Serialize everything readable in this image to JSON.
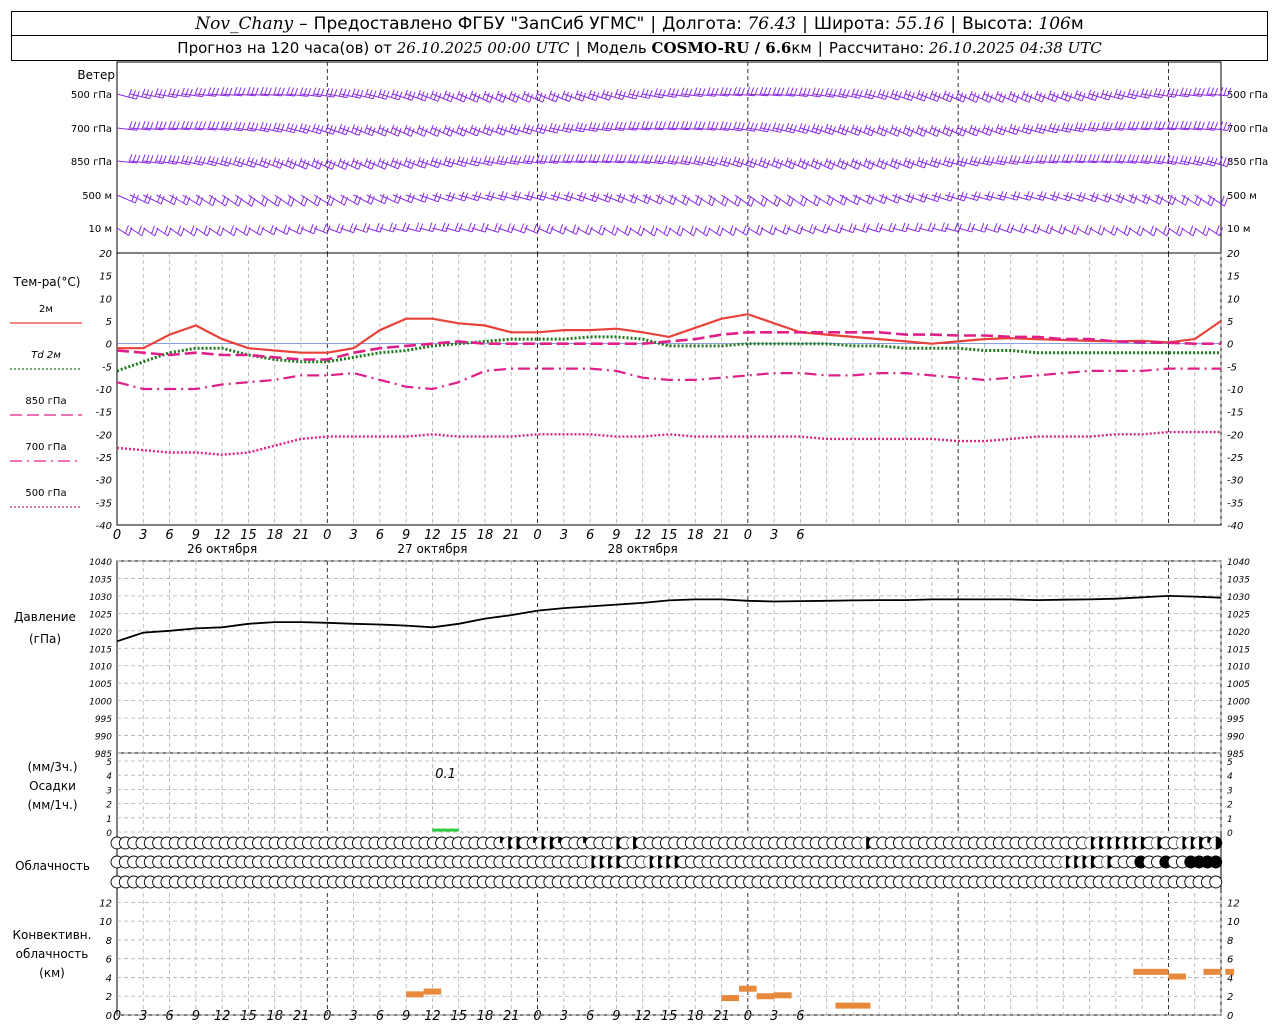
{
  "header": {
    "station": "Nov_Chany",
    "provider": "Предоставлено ФГБУ \"ЗапСиб УГМС\"",
    "lon_label": "Долгота:",
    "lon_value": "76.43",
    "lat_label": "Широта:",
    "lat_value": "55.16",
    "alt_label": "Высота:",
    "alt_value": "106",
    "alt_unit": "м",
    "forecast_prefix": "Прогноз на 120 часа(ов) от",
    "forecast_start": "26.10.2025 00:00 UTC",
    "model_label": "Модель",
    "model_name": "COSMO-RU / 6.6",
    "model_unit": "км",
    "computed_label": "Рассчитано:",
    "computed_value": "26.10.2025 04:38 UTC"
  },
  "labels": {
    "wind_title": "Ветер",
    "temp_title": "Тем-ра(°С)",
    "pressure_title": "Давление",
    "pressure_unit": "(гПа)",
    "precip_unit_top": "(мм/3ч.)",
    "precip_title": "Осадки",
    "precip_unit_bottom": "(мм/1ч.)",
    "cloud_title": "Облачность",
    "conv_line1": "Конвективн.",
    "conv_line2": "облачность",
    "conv_unit": "(км)",
    "precip_max": "0.1"
  },
  "colors": {
    "wind": "#8a2be2",
    "t2m": "#e8423a",
    "td2m": "#1a7a1a",
    "t850": "#e0208a",
    "t700": "#e0208a",
    "t500": "#e0208a",
    "pressure": "#000000",
    "precip": "#2ecc40",
    "conv": "#e8883a",
    "grid": "#b0b0b0"
  },
  "chart_data": [
    {
      "type": "wind-barbs",
      "levels": [
        "500 гПа",
        "700 гПа",
        "850 гПа",
        "500 м",
        "10  м"
      ],
      "x_ticks": [
        "0",
        "3",
        "6",
        "9",
        "12",
        "15",
        "18",
        "21",
        "0",
        "3",
        "6",
        "9",
        "12",
        "15",
        "18",
        "21",
        "0",
        "3",
        "6",
        "9",
        "12",
        "15",
        "18",
        "21",
        "0",
        "3",
        "6"
      ]
    },
    {
      "type": "line",
      "ylabel": "Тем-ра(°С)",
      "ylim": [
        -40,
        20
      ],
      "yticks": [
        20,
        15,
        10,
        5,
        0,
        -5,
        -10,
        -15,
        -20,
        -25,
        -30,
        -35,
        -40
      ],
      "x_unit": "hours from 26.10.2025 00 UTC",
      "xlim": [
        0,
        126
      ],
      "x_ticks": [
        "0",
        "3",
        "6",
        "9",
        "12",
        "15",
        "18",
        "21",
        "0",
        "3",
        "6",
        "9",
        "12",
        "15",
        "18",
        "21",
        "0",
        "3",
        "6",
        "9",
        "12",
        "15",
        "18",
        "21",
        "0",
        "3",
        "6"
      ],
      "day_labels": [
        "26 октября",
        "27 октября",
        "28 октября"
      ],
      "series": [
        {
          "name": "2м",
          "style": "solid",
          "x": [
            0,
            3,
            6,
            9,
            12,
            15,
            18,
            21,
            24,
            27,
            30,
            33,
            36,
            39,
            42,
            45,
            48,
            51,
            54,
            57,
            60,
            63,
            66,
            69,
            72,
            75,
            78,
            81,
            84,
            87,
            90,
            93,
            96,
            99,
            102,
            105,
            108,
            111,
            114,
            117,
            120,
            123,
            126
          ],
          "y": [
            -1,
            -1,
            2,
            4,
            1,
            -1,
            -1.5,
            -2,
            -2,
            -1,
            3,
            5.5,
            5.5,
            4.5,
            4,
            2.5,
            2.5,
            3,
            3,
            3.3,
            2.5,
            1.5,
            3.5,
            5.5,
            6.5,
            4.5,
            2.5,
            2,
            1.5,
            1,
            0.5,
            0,
            0.5,
            1,
            1.2,
            1,
            0.8,
            0.6,
            0.5,
            0.6,
            0.3,
            1,
            5
          ]
        },
        {
          "name": "Td  2м",
          "style": "dotted",
          "x": [
            0,
            3,
            6,
            9,
            12,
            15,
            18,
            21,
            24,
            27,
            30,
            33,
            36,
            39,
            42,
            45,
            48,
            51,
            54,
            57,
            60,
            63,
            66,
            69,
            72,
            75,
            78,
            81,
            84,
            87,
            90,
            93,
            96,
            99,
            102,
            105,
            108,
            111,
            114,
            117,
            120,
            123,
            126
          ],
          "y": [
            -6,
            -4,
            -2,
            -1,
            -1,
            -2.5,
            -3.5,
            -4,
            -4,
            -3,
            -2,
            -1.5,
            -0.5,
            0,
            0.5,
            1,
            1,
            1,
            1.5,
            1.5,
            1,
            -0.5,
            -0.5,
            -0.5,
            0,
            0,
            0,
            0,
            -0.5,
            -0.5,
            -1,
            -1,
            -1,
            -1.5,
            -1.5,
            -2,
            -2,
            -2,
            -2,
            -2,
            -2,
            -2,
            -2
          ]
        },
        {
          "name": "850 гПа",
          "style": "dash",
          "x": [
            0,
            3,
            6,
            9,
            12,
            15,
            18,
            21,
            24,
            27,
            30,
            33,
            36,
            39,
            42,
            45,
            48,
            51,
            54,
            57,
            60,
            63,
            66,
            69,
            72,
            75,
            78,
            81,
            84,
            87,
            90,
            93,
            96,
            99,
            102,
            105,
            108,
            111,
            114,
            117,
            120,
            123,
            126
          ],
          "y": [
            -1.5,
            -2,
            -2.5,
            -2,
            -2.5,
            -2.5,
            -3,
            -3.5,
            -3.5,
            -2,
            -1,
            -0.5,
            0,
            0.5,
            0,
            0,
            0,
            0,
            0,
            0,
            0,
            0.5,
            1,
            2,
            2.5,
            2.5,
            2.5,
            2.5,
            2.5,
            2.5,
            2,
            2,
            1.8,
            1.8,
            1.5,
            1.5,
            1,
            1,
            0.5,
            0.3,
            0.2,
            0,
            0
          ]
        },
        {
          "name": "700 гПа",
          "style": "dashdot",
          "x": [
            0,
            3,
            6,
            9,
            12,
            15,
            18,
            21,
            24,
            27,
            30,
            33,
            36,
            39,
            42,
            45,
            48,
            51,
            54,
            57,
            60,
            63,
            66,
            69,
            72,
            75,
            78,
            81,
            84,
            87,
            90,
            93,
            96,
            99,
            102,
            105,
            108,
            111,
            114,
            117,
            120,
            123,
            126
          ],
          "y": [
            -8.5,
            -10,
            -10,
            -10,
            -9,
            -8.5,
            -8,
            -7,
            -7,
            -6.5,
            -8,
            -9.5,
            -10,
            -8.5,
            -6,
            -5.5,
            -5.5,
            -5.5,
            -5.5,
            -6,
            -7.5,
            -8,
            -8,
            -7.5,
            -7,
            -6.5,
            -6.5,
            -7,
            -7,
            -6.5,
            -6.5,
            -7,
            -7.5,
            -8,
            -7.5,
            -7,
            -6.5,
            -6,
            -6,
            -6,
            -5.5,
            -5.5,
            -5.5
          ]
        },
        {
          "name": "500 гПа",
          "style": "dotted",
          "x": [
            0,
            3,
            6,
            9,
            12,
            15,
            18,
            21,
            24,
            27,
            30,
            33,
            36,
            39,
            42,
            45,
            48,
            51,
            54,
            57,
            60,
            63,
            66,
            69,
            72,
            75,
            78,
            81,
            84,
            87,
            90,
            93,
            96,
            99,
            102,
            105,
            108,
            111,
            114,
            117,
            120,
            123,
            126
          ],
          "y": [
            -23,
            -23.5,
            -24,
            -24,
            -24.5,
            -24,
            -22.5,
            -21,
            -20.5,
            -20.5,
            -20.5,
            -20.5,
            -20,
            -20.5,
            -20.5,
            -20.5,
            -20,
            -20,
            -20,
            -20.5,
            -20.5,
            -20,
            -20.5,
            -20.5,
            -20.5,
            -20.5,
            -20.5,
            -21,
            -21,
            -21,
            -21,
            -21,
            -21.5,
            -21.5,
            -21,
            -20.5,
            -20.5,
            -20.5,
            -20,
            -20,
            -19.5,
            -19.5,
            -19.5
          ]
        }
      ]
    },
    {
      "type": "line",
      "ylabel": "Давление",
      "yunit": "(гПа)",
      "ylim": [
        985,
        1040
      ],
      "yticks": [
        1040,
        1035,
        1030,
        1025,
        1020,
        1015,
        1010,
        1005,
        1000,
        995,
        990,
        985
      ],
      "series": [
        {
          "name": "pressure",
          "x": [
            0,
            3,
            6,
            9,
            12,
            15,
            18,
            21,
            24,
            27,
            30,
            33,
            36,
            39,
            42,
            45,
            48,
            51,
            54,
            57,
            60,
            63,
            66,
            69,
            72,
            75,
            78,
            81,
            84,
            87,
            90,
            93,
            96,
            99,
            102,
            105,
            108,
            111,
            114,
            117,
            120,
            123,
            126
          ],
          "y": [
            1017,
            1019.5,
            1020,
            1020.7,
            1021,
            1022,
            1022.5,
            1022.5,
            1022.3,
            1022,
            1021.8,
            1021.5,
            1021,
            1022,
            1023.5,
            1024.5,
            1025.8,
            1026.5,
            1027,
            1027.5,
            1028,
            1028.7,
            1029,
            1029,
            1028.6,
            1028.4,
            1028.5,
            1028.6,
            1028.7,
            1028.8,
            1028.8,
            1029,
            1029,
            1029,
            1029,
            1028.8,
            1028.9,
            1029,
            1029.2,
            1029.6,
            1030,
            1029.8,
            1029.5
          ]
        }
      ]
    },
    {
      "type": "bar",
      "ylabel": "Осадки",
      "ylim": [
        0,
        5
      ],
      "yticks": [
        5,
        4,
        3,
        2,
        1,
        0
      ],
      "max_label": "0.1",
      "bars": [
        {
          "x": [
            36,
            39
          ],
          "value": 0.1
        }
      ]
    },
    {
      "type": "table",
      "name": "Облачность",
      "rows": [
        "high",
        "mid",
        "low"
      ],
      "step_hours": 1,
      "note": "cloud cover symbols 0 (empty circle) to 8 (filled circle) octas per hour",
      "high": "0000000000000000000000000000000000000000000000244024420030004040000000000000000000000000004000000000000000000000000007444444040044424",
      "mid": "0000000000000000000000000000000000000000000000000000000004444000444400000000000000000000000000000000000000000000004444040008008008888",
      "low": "0000000000000000000000000000000000000000000000000000000000000000000000000000000000000000000000000000000000000000000000000000000000000"
    },
    {
      "type": "bar",
      "ylabel": "Конвективн. облачность (км)",
      "ylim": [
        0,
        13
      ],
      "yticks": [
        12,
        10,
        8,
        6,
        4,
        2,
        0
      ],
      "segments": [
        {
          "x": [
            33,
            35
          ],
          "y": 2.2
        },
        {
          "x": [
            35,
            37
          ],
          "y": 2.5
        },
        {
          "x": [
            69,
            71
          ],
          "y": 1.8
        },
        {
          "x": [
            71,
            73
          ],
          "y": 2.8
        },
        {
          "x": [
            73,
            75
          ],
          "y": 2.0
        },
        {
          "x": [
            75,
            77
          ],
          "y": 2.1
        },
        {
          "x": [
            82,
            86
          ],
          "y": 1.0
        },
        {
          "x": [
            116,
            118
          ],
          "y": 4.6
        },
        {
          "x": [
            118,
            120
          ],
          "y": 4.6
        },
        {
          "x": [
            120,
            122
          ],
          "y": 4.1
        },
        {
          "x": [
            124,
            126
          ],
          "y": 4.6
        },
        {
          "x": [
            126.5,
            127.5
          ],
          "y": 4.6
        }
      ]
    }
  ]
}
